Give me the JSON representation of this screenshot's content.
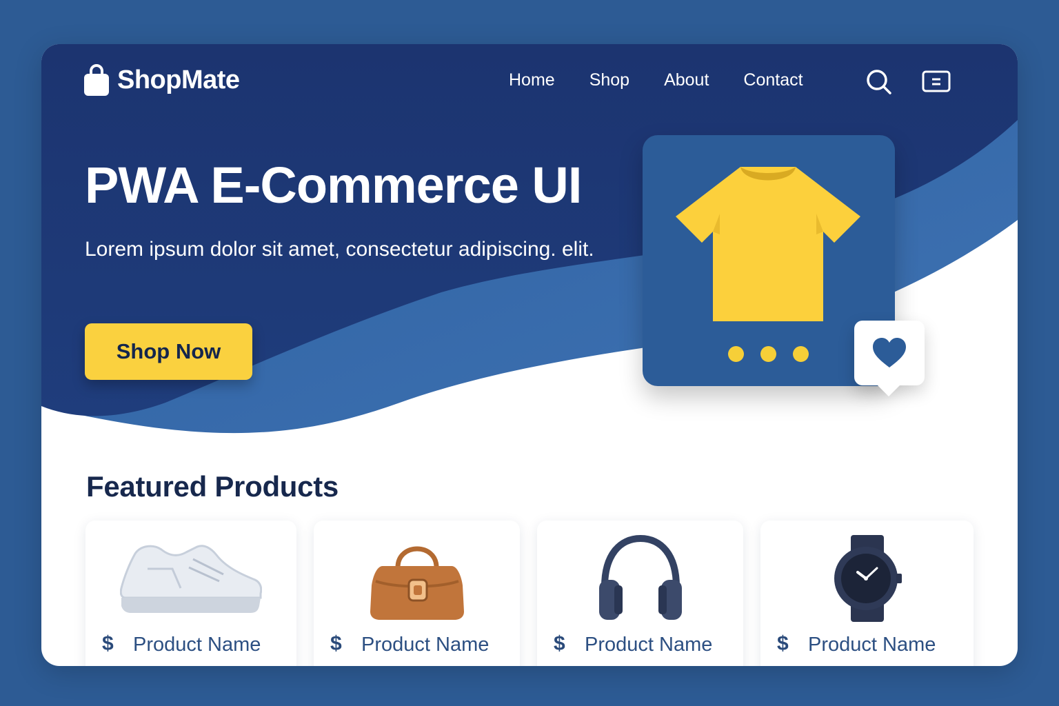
{
  "header": {
    "brand": "ShopMate",
    "nav": [
      "Home",
      "Shop",
      "About",
      "Contact"
    ]
  },
  "hero": {
    "title": "PWA E-Commerce UI",
    "subtitle": "Lorem ipsum dolor sit amet, consectetur adipiscing. elit.",
    "cta_label": "Shop Now"
  },
  "featured": {
    "title": "Featured Products",
    "products": [
      {
        "currency": "$",
        "name": "Product Name",
        "icon": "sneaker-icon"
      },
      {
        "currency": "$",
        "name": "Product Name",
        "icon": "handbag-icon"
      },
      {
        "currency": "$",
        "name": "Product Name",
        "icon": "headphones-icon"
      },
      {
        "currency": "$",
        "name": "Product Name",
        "icon": "watch-icon"
      }
    ]
  },
  "colors": {
    "page_bg": "#2d5b94",
    "hero_dark": "#1d3873",
    "accent_yellow": "#fad13f",
    "text_dark": "#17284d"
  }
}
